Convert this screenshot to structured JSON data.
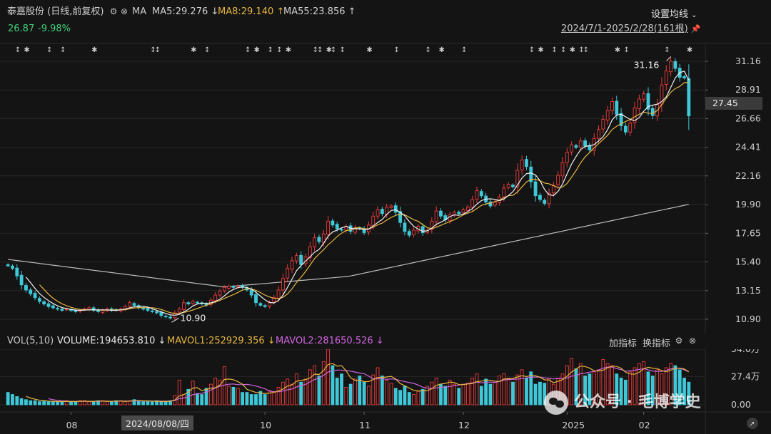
{
  "header": {
    "stock_name": "泰嘉股份",
    "period_label": "(日线,前复权)",
    "ma_label": "MA",
    "ma_values": [
      {
        "text": "MA5:29.276 ↓",
        "color": "#e8e8e8"
      },
      {
        "text": "MA8:29.140 ↑",
        "color": "#e5b53f"
      },
      {
        "text": "MA55:23.856 ↑",
        "color": "#e8e8e8"
      }
    ],
    "price": "26.87",
    "change_pct": "-9.98%",
    "settings_label": "设置均线",
    "date_range": "2024/7/1-2025/2/28(161根)"
  },
  "volume_header": {
    "label": "VOL(5,10)",
    "volume_text": "VOLUME:194653.810 ↓",
    "mavol1_text": "MAVOL1:252929.356 ↓",
    "mavol2_text": "MAVOL2:281650.526 ↓",
    "add_indicator": "加指标",
    "switch_indicator": "换指标"
  },
  "price_current_label": "27.45",
  "date_cursor": "2024/08/08/四",
  "watermark": "公众号 · 毛博学史",
  "colors": {
    "up": "#ee3b3b",
    "down": "#3ec8d8",
    "ma5": "#f0f0f0",
    "ma8": "#e5b53f",
    "ma55": "#bdbdbd",
    "mavol1": "#e5b53f",
    "mavol2": "#d065e0",
    "change": "#3fd07a"
  },
  "chart_data": {
    "type": "candlestick",
    "price_axis": {
      "ticks": [
        "31.16",
        "28.91",
        "26.66",
        "24.41",
        "22.16",
        "19.90",
        "17.65",
        "15.40",
        "13.15",
        "10.90"
      ],
      "range": [
        10.9,
        31.16
      ]
    },
    "volume_axis": {
      "ticks": [
        "54.0万",
        "27.4万",
        "0.00"
      ],
      "range": [
        0,
        540000
      ]
    },
    "x_tick_labels": [
      "08",
      "10",
      "11",
      "12",
      "2025",
      "02"
    ],
    "annotations": {
      "high": "31.16",
      "low": "10.90"
    },
    "close": [
      15.1,
      14.9,
      14.3,
      13.6,
      13.2,
      12.9,
      12.6,
      12.3,
      12.1,
      11.9,
      11.8,
      11.7,
      11.6,
      11.7,
      11.6,
      11.5,
      11.6,
      11.7,
      11.8,
      11.6,
      11.5,
      11.6,
      11.7,
      11.6,
      11.6,
      11.7,
      11.9,
      12.2,
      12.0,
      11.8,
      11.7,
      11.6,
      11.5,
      11.4,
      11.2,
      11.1,
      11.0,
      11.4,
      11.7,
      12.2,
      12.1,
      12.3,
      12.2,
      12.1,
      12.0,
      12.4,
      12.8,
      13.1,
      13.4,
      13.5,
      13.4,
      13.5,
      13.4,
      13.2,
      12.8,
      12.2,
      12.0,
      11.9,
      12.2,
      12.6,
      13.2,
      14.1,
      14.9,
      15.5,
      15.9,
      15.2,
      15.8,
      16.6,
      17.3,
      17.0,
      17.6,
      18.6,
      18.3,
      18.0,
      17.9,
      18.2,
      17.8,
      18.1,
      18.0,
      17.7,
      18.3,
      19.0,
      19.5,
      19.2,
      19.7,
      19.8,
      19.3,
      18.5,
      17.8,
      17.5,
      17.9,
      18.2,
      17.7,
      17.9,
      18.6,
      19.4,
      19.0,
      18.7,
      19.1,
      19.3,
      19.2,
      19.5,
      19.7,
      20.3,
      21.0,
      20.6,
      20.1,
      19.8,
      20.1,
      20.5,
      21.2,
      21.5,
      21.3,
      22.6,
      23.4,
      22.9,
      21.7,
      20.6,
      20.3,
      20.0,
      20.8,
      21.4,
      22.2,
      23.2,
      24.0,
      24.6,
      24.4,
      24.9,
      24.5,
      24.2,
      25.1,
      25.8,
      26.6,
      27.3,
      28.0,
      27.0,
      26.1,
      25.6,
      26.3,
      27.5,
      28.2,
      28.6,
      27.4,
      26.9,
      27.8,
      29.3,
      30.4,
      31.16,
      30.6,
      29.9,
      29.85,
      26.87
    ],
    "volume_wan": [
      12,
      10,
      8,
      6,
      5,
      4,
      4,
      3,
      4,
      3,
      3,
      3,
      3,
      4,
      3,
      3,
      4,
      4,
      3,
      3,
      4,
      4,
      3,
      3,
      4,
      4,
      3,
      4,
      5,
      4,
      3,
      3,
      3,
      4,
      3,
      3,
      4,
      9,
      24,
      10,
      15,
      23,
      11,
      10,
      16,
      20,
      26,
      24,
      37,
      18,
      17,
      16,
      12,
      12,
      10,
      10,
      13,
      10,
      14,
      13,
      17,
      22,
      25,
      20,
      30,
      22,
      25,
      34,
      38,
      28,
      42,
      54,
      38,
      26,
      30,
      17,
      20,
      25,
      28,
      22,
      18,
      29,
      36,
      28,
      24,
      21,
      16,
      14,
      18,
      12,
      10,
      13,
      15,
      18,
      22,
      26,
      20,
      18,
      24,
      20,
      16,
      20,
      21,
      26,
      30,
      18,
      25,
      20,
      22,
      28,
      30,
      26,
      22,
      29,
      34,
      26,
      32,
      20,
      22,
      21,
      25,
      20,
      26,
      30,
      38,
      45,
      35,
      40,
      28,
      30,
      32,
      34,
      44,
      40,
      38,
      30,
      26,
      24,
      32,
      36,
      40,
      42,
      32,
      28,
      34,
      30,
      36,
      40,
      38,
      34,
      26,
      22
    ]
  }
}
